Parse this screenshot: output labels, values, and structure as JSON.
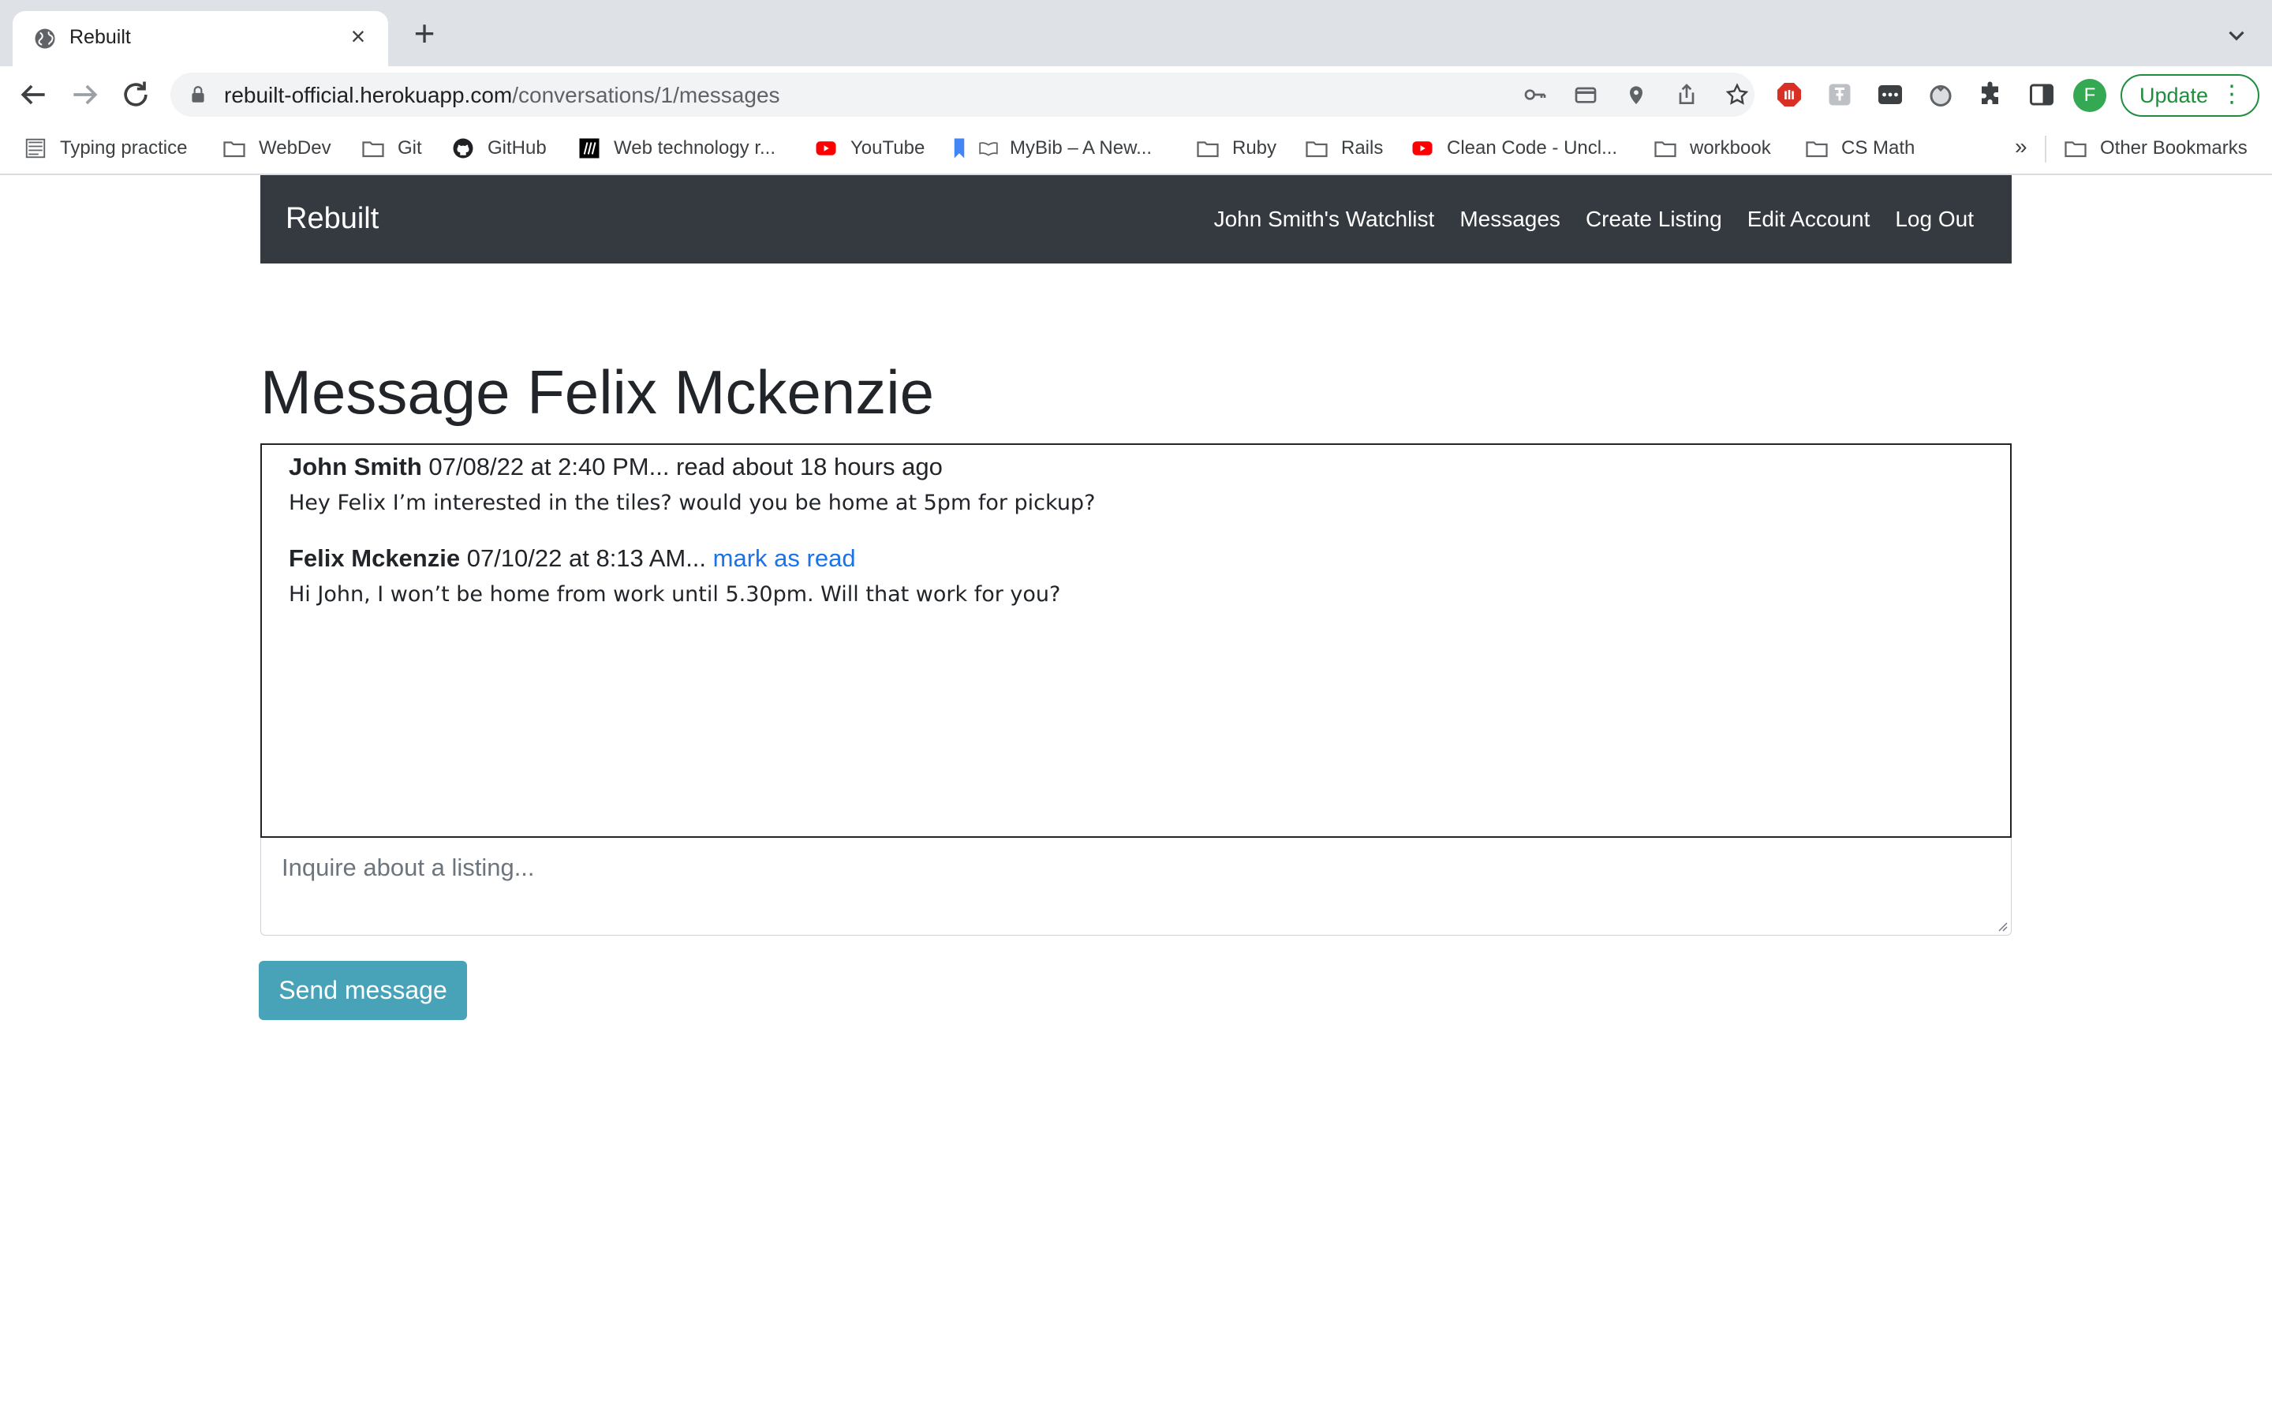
{
  "browser": {
    "tab": {
      "title": "Rebuilt"
    },
    "url": {
      "host": "rebuilt-official.herokuapp.com",
      "path": "/conversations/1/messages"
    },
    "profile_initial": "F",
    "update_label": "Update",
    "bookmarks": [
      {
        "label": "Typing practice",
        "icon": "typing-favicon"
      },
      {
        "label": "WebDev",
        "icon": "folder-icon"
      },
      {
        "label": "Git",
        "icon": "folder-icon"
      },
      {
        "label": "GitHub",
        "icon": "github-icon"
      },
      {
        "label": "Web technology r...",
        "icon": "mdn-icon"
      },
      {
        "label": "YouTube",
        "icon": "youtube-icon"
      },
      {
        "label": "MyBib – A New...",
        "icon": "mybib-icon"
      },
      {
        "label": "Ruby",
        "icon": "folder-icon"
      },
      {
        "label": "Rails",
        "icon": "folder-icon"
      },
      {
        "label": "Clean Code - Uncl...",
        "icon": "youtube-icon"
      },
      {
        "label": "workbook",
        "icon": "folder-icon"
      },
      {
        "label": "CS Math",
        "icon": "folder-icon"
      }
    ],
    "bookmarks_more": "»",
    "other_bookmarks": "Other Bookmarks"
  },
  "app": {
    "brand": "Rebuilt",
    "nav": {
      "watchlist": "John Smith's Watchlist",
      "messages": "Messages",
      "create_listing": "Create Listing",
      "edit_account": "Edit Account",
      "log_out": "Log Out"
    },
    "page_title": "Message Felix Mckenzie",
    "messages": [
      {
        "author": "John Smith",
        "meta": " 07/08/22 at 2:40 PM... read about 18 hours ago",
        "body": "Hey Felix I’m interested in the tiles? would you be home at 5pm for pickup?"
      },
      {
        "author": "Felix Mckenzie",
        "meta": " 07/10/22 at 8:13 AM... ",
        "action": "mark as read",
        "body": "Hi John, I won’t be home from work until 5.30pm. Will that work for you?"
      }
    ],
    "reply": {
      "placeholder": "Inquire about a listing...",
      "value": ""
    },
    "send_label": "Send message"
  },
  "colors": {
    "navbar": "#343a40",
    "send_button": "#48a2b8",
    "link": "#1a73e8",
    "update_green": "#1e8e3e"
  }
}
